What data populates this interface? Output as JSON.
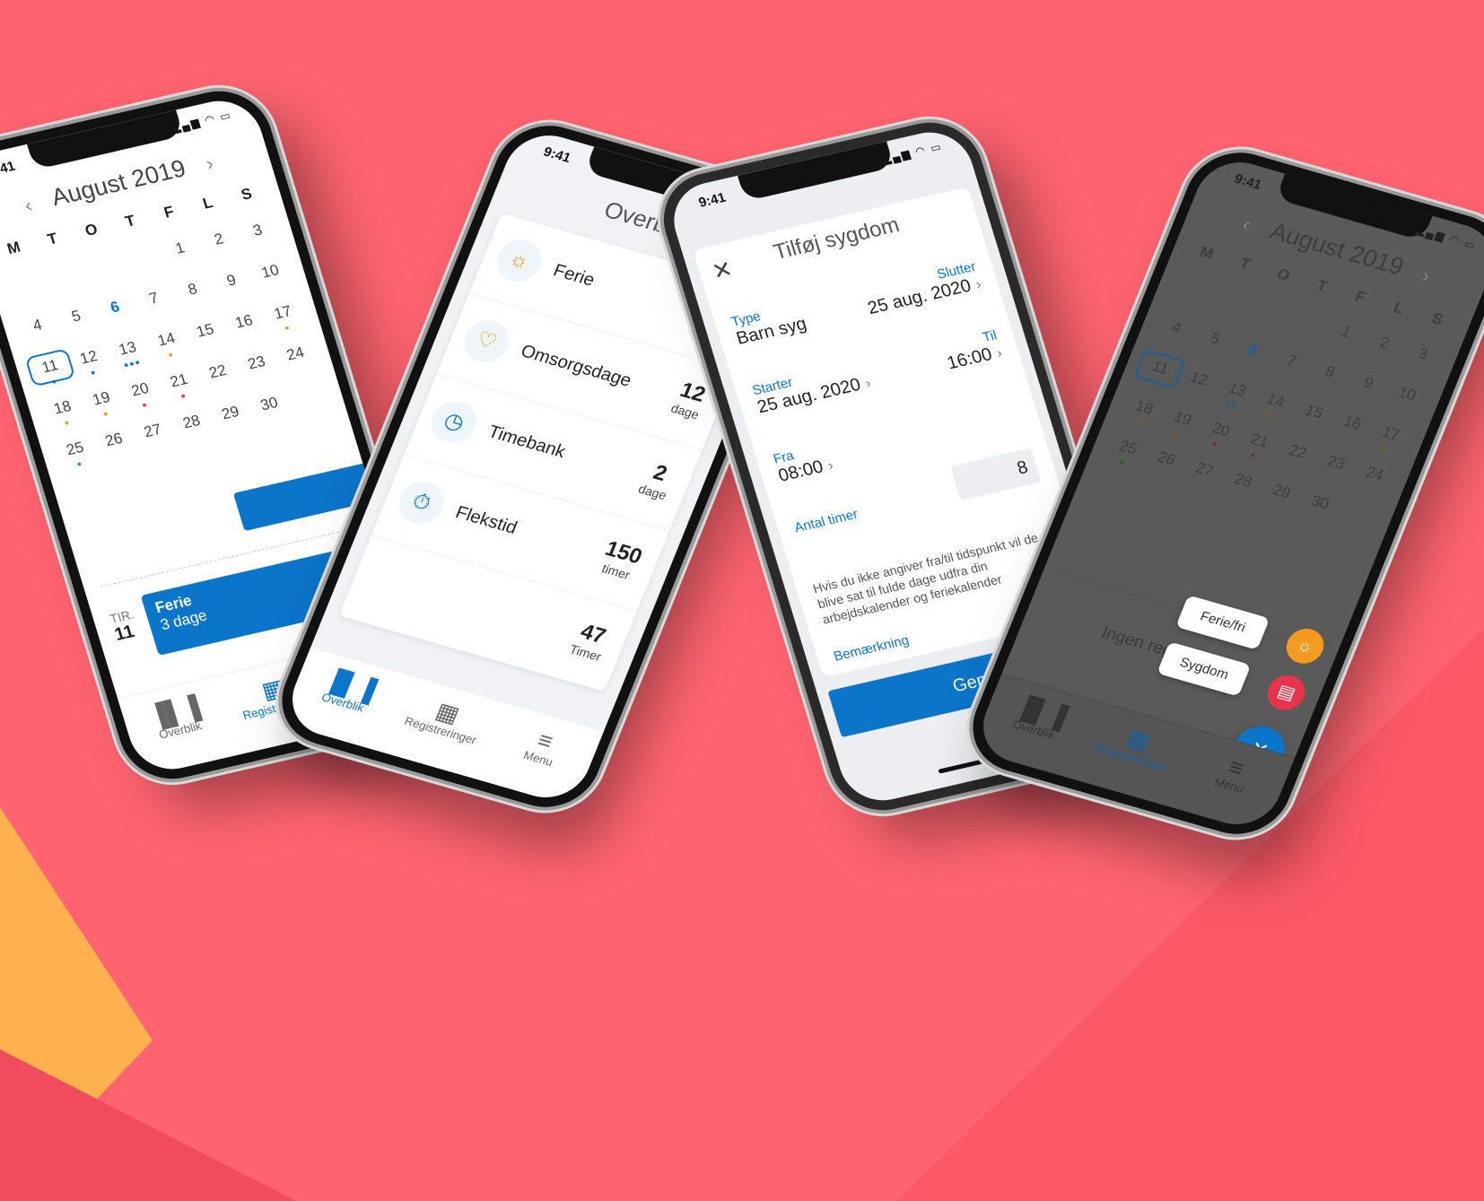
{
  "status": {
    "time": "9:41"
  },
  "calendar": {
    "month": "August 2019",
    "weekdays": [
      "M",
      "T",
      "O",
      "T",
      "F",
      "L",
      "S"
    ],
    "days": [
      "1",
      "2",
      "3",
      "4",
      "5",
      "6",
      "7",
      "8",
      "9",
      "10",
      "11",
      "12",
      "13",
      "14",
      "15",
      "16",
      "17",
      "18",
      "19",
      "20",
      "21",
      "22",
      "23",
      "24",
      "25",
      "26",
      "27",
      "28",
      "29",
      "30"
    ],
    "event": {
      "day_label": "TIR.",
      "day_number": "11",
      "title": "Ferie",
      "duration": "3 dage"
    },
    "empty_text": "Ingen registreringer"
  },
  "tabs": {
    "overview": "Overblik",
    "registrations": "Registreringer",
    "menu": "Menu"
  },
  "overview": {
    "title": "Overblik",
    "rows": [
      {
        "label": "Ferie",
        "value": "",
        "unit": ""
      },
      {
        "label": "Omsorgsdage",
        "value": "12",
        "unit": "dage"
      },
      {
        "label": "Timebank",
        "value": "2",
        "unit": "dage"
      },
      {
        "label": "Flekstid",
        "value": "150",
        "unit": "timer"
      },
      {
        "label": "",
        "value": "47",
        "unit": "Timer"
      }
    ]
  },
  "sick_form": {
    "title": "Tilføj sygdom",
    "type_label": "Type",
    "type_value": "Barn syg",
    "ends_label": "Slutter",
    "ends_value": "25 aug. 2020",
    "starts_label": "Starter",
    "starts_value": "25 aug. 2020",
    "to_label": "Til",
    "to_value": "16:00",
    "from_label": "Fra",
    "from_value": "08:00",
    "hours_label": "Antal timer",
    "hours_value": "8",
    "hint": "Hvis du ikke angiver fra/til tidspunkt vil de blive sat til fulde dage udfra din arbejdskalender og feriekalender",
    "remark_label": "Bemærkning",
    "save": "Gem"
  },
  "quick_add": {
    "vacation": "Ferie/fri",
    "sick": "Sygdom"
  },
  "colors": {
    "brand_blue": "#0b75c9",
    "background": "#fe6470",
    "accent_orange": "#f29b1e"
  }
}
